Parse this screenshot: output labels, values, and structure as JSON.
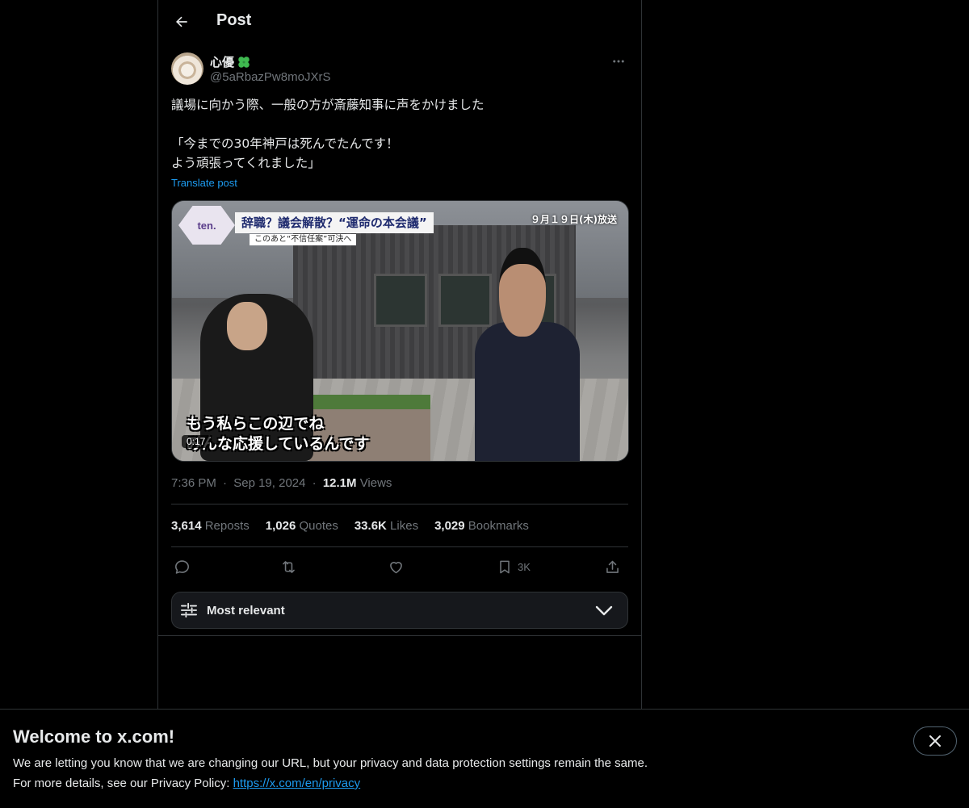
{
  "header": {
    "title": "Post"
  },
  "author": {
    "name": "心優",
    "handle": "@5aRbazPw8moJXrS"
  },
  "post": {
    "line1": "議場に向かう際、一般の方が斎藤知事に声をかけました",
    "line2": "「今までの30年神戸は死んでたんです！\nよう頑張ってくれました」",
    "translate_label": "Translate post"
  },
  "media": {
    "logo_text": "ten.",
    "headline": "辞職？議会解散？“運命の本会議”",
    "subheadline": "このあと“不信任案”可決へ",
    "date_overlay": "９月１９日(木)放送",
    "caption": "もう私らこの辺でね\nみんな応援しているんです",
    "duration": "0:17"
  },
  "meta": {
    "time": "7:36 PM",
    "sep1": "·",
    "date": "Sep 19, 2024",
    "sep2": "·",
    "views_count": "12.1M",
    "views_label": "Views"
  },
  "stats": {
    "reposts_count": "3,614",
    "reposts_label": "Reposts",
    "quotes_count": "1,026",
    "quotes_label": "Quotes",
    "likes_count": "33.6K",
    "likes_label": "Likes",
    "bookmarks_count": "3,029",
    "bookmarks_label": "Bookmarks"
  },
  "actions": {
    "bookmark_count": "3K"
  },
  "sort": {
    "label": "Most relevant"
  },
  "banner": {
    "title": "Welcome to x.com!",
    "line1": "We are letting you know that we are changing our URL, but your privacy and data protection settings remain the same.",
    "line2_prefix": "For more details, see our Privacy Policy: ",
    "link": "https://x.com/en/privacy"
  },
  "colors": {
    "background": "#000000",
    "text": "#e7e9ea",
    "secondary_text": "#71767b",
    "accent": "#1d9bf0",
    "border": "#2f3336",
    "clover": "#3fb950"
  },
  "icons": {
    "back": "arrow-left-icon",
    "more": "more-horizontal-icon",
    "reply": "reply-icon",
    "repost": "repost-icon",
    "like": "heart-icon",
    "bookmark": "bookmark-icon",
    "share": "share-icon",
    "sort": "sliders-icon",
    "chevron": "chevron-down-icon",
    "close": "close-icon",
    "clover": "clover-icon"
  }
}
